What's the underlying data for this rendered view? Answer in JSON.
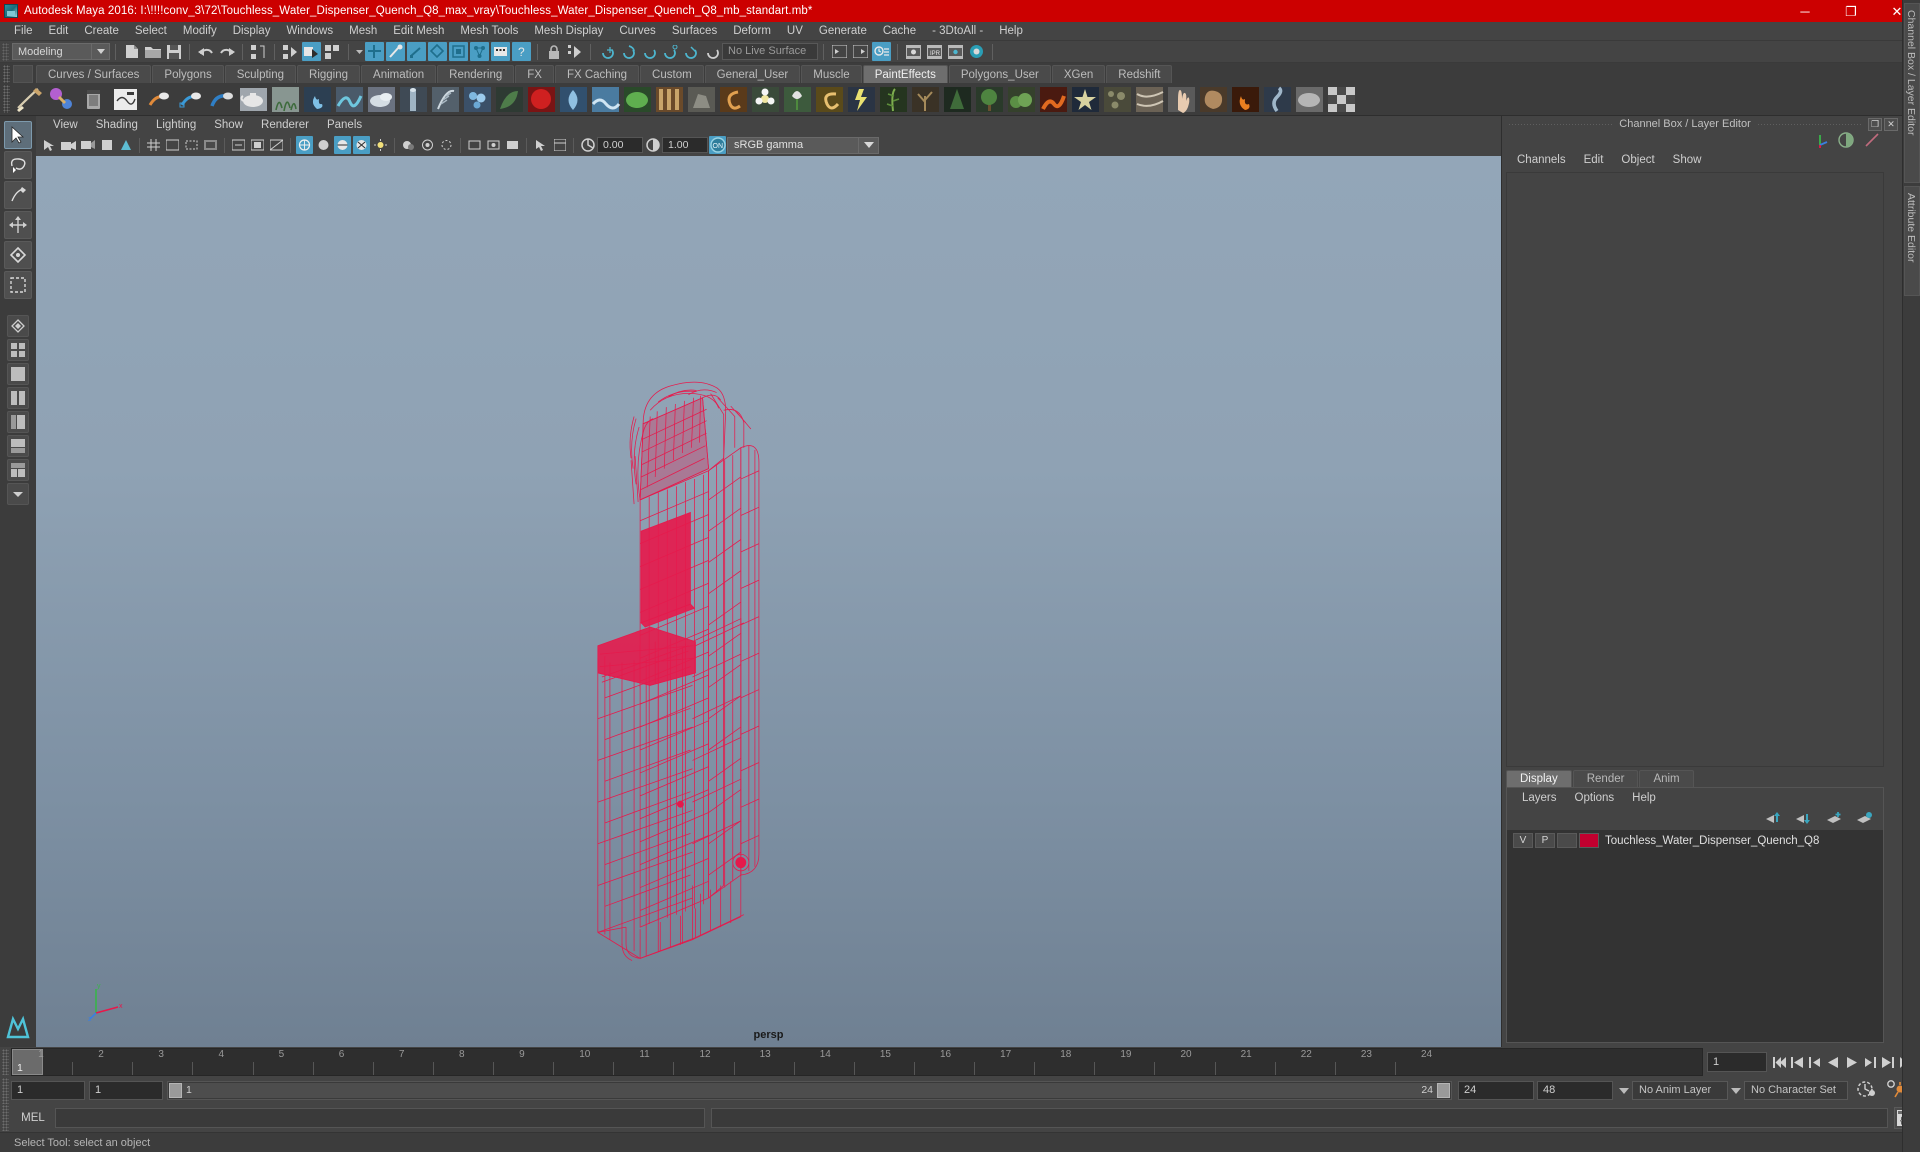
{
  "titlebar": {
    "app_icon": "maya-icon",
    "title": "Autodesk Maya 2016: I:\\!!!!conv_3\\72\\Touchless_Water_Dispenser_Quench_Q8_max_vray\\Touchless_Water_Dispenser_Quench_Q8_mb_standart.mb*",
    "minimize": "─",
    "maximize": "❐",
    "close": "✕",
    "bg_color": "#cc0000"
  },
  "menubar": {
    "items": [
      "File",
      "Edit",
      "Create",
      "Select",
      "Modify",
      "Display",
      "Windows",
      "Mesh",
      "Edit Mesh",
      "Mesh Tools",
      "Mesh Display",
      "Curves",
      "Surfaces",
      "Deform",
      "UV",
      "Generate",
      "Cache",
      "- 3DtoAll -",
      "Help"
    ]
  },
  "statusline": {
    "mode": "Modeling",
    "live_surface": "No Live Surface",
    "dropdown_arrow": "▼"
  },
  "shelf": {
    "tabs": [
      "Curves / Surfaces",
      "Polygons",
      "Sculpting",
      "Rigging",
      "Animation",
      "Rendering",
      "FX",
      "FX Caching",
      "Custom",
      "General_User",
      "Muscle",
      "PaintEffects",
      "Polygons_User",
      "XGen",
      "Redshift"
    ],
    "active_tab": "PaintEffects"
  },
  "viewport": {
    "menus": [
      "View",
      "Shading",
      "Lighting",
      "Show",
      "Renderer",
      "Panels"
    ],
    "exposure": "0.00",
    "gamma": "1.00",
    "color_profile": "sRGB gamma",
    "camera_label": "persp",
    "wireframe_color": "#e8174a",
    "bg_top": "#93a6b8",
    "bg_bottom": "#6f8092"
  },
  "channelbox": {
    "panel_title": "Channel Box / Layer Editor",
    "menus": [
      "Channels",
      "Edit",
      "Object",
      "Show"
    ],
    "restore_glyph": "❐",
    "close_glyph": "✕",
    "side_tabs": [
      "Channel Box / Layer Editor",
      "Attribute Editor"
    ]
  },
  "layereditor": {
    "tabs": [
      "Display",
      "Render",
      "Anim"
    ],
    "active_tab": "Display",
    "menus": [
      "Layers",
      "Options",
      "Help"
    ],
    "columns": [
      "V",
      "P"
    ],
    "layers": [
      {
        "visible": "V",
        "playback": "P",
        "color": "#c2002f",
        "name": "Touchless_Water_Dispenser_Quench_Q8"
      }
    ]
  },
  "timeslider": {
    "ticks": [
      "1",
      "2",
      "3",
      "4",
      "5",
      "6",
      "7",
      "8",
      "9",
      "10",
      "11",
      "12",
      "13",
      "14",
      "15",
      "16",
      "17",
      "18",
      "19",
      "20",
      "21",
      "22",
      "23",
      "24"
    ],
    "current_frame": "1",
    "frame_field": "1",
    "playback_buttons": [
      "go-to-start",
      "step-back-key",
      "step-back-frame",
      "play-backwards",
      "play-forwards",
      "step-forward-frame",
      "step-forward-key",
      "go-to-end"
    ]
  },
  "rangeslider": {
    "start": "1",
    "anim_start": "1",
    "bar_start_label": "1",
    "bar_end_label": "24",
    "anim_end": "24",
    "end": "48",
    "anim_layer": "No Anim Layer",
    "character_set": "No Character Set"
  },
  "commandline": {
    "label": "MEL",
    "input_value": "",
    "output_value": ""
  },
  "helpline": {
    "text": "Select Tool: select an object"
  }
}
